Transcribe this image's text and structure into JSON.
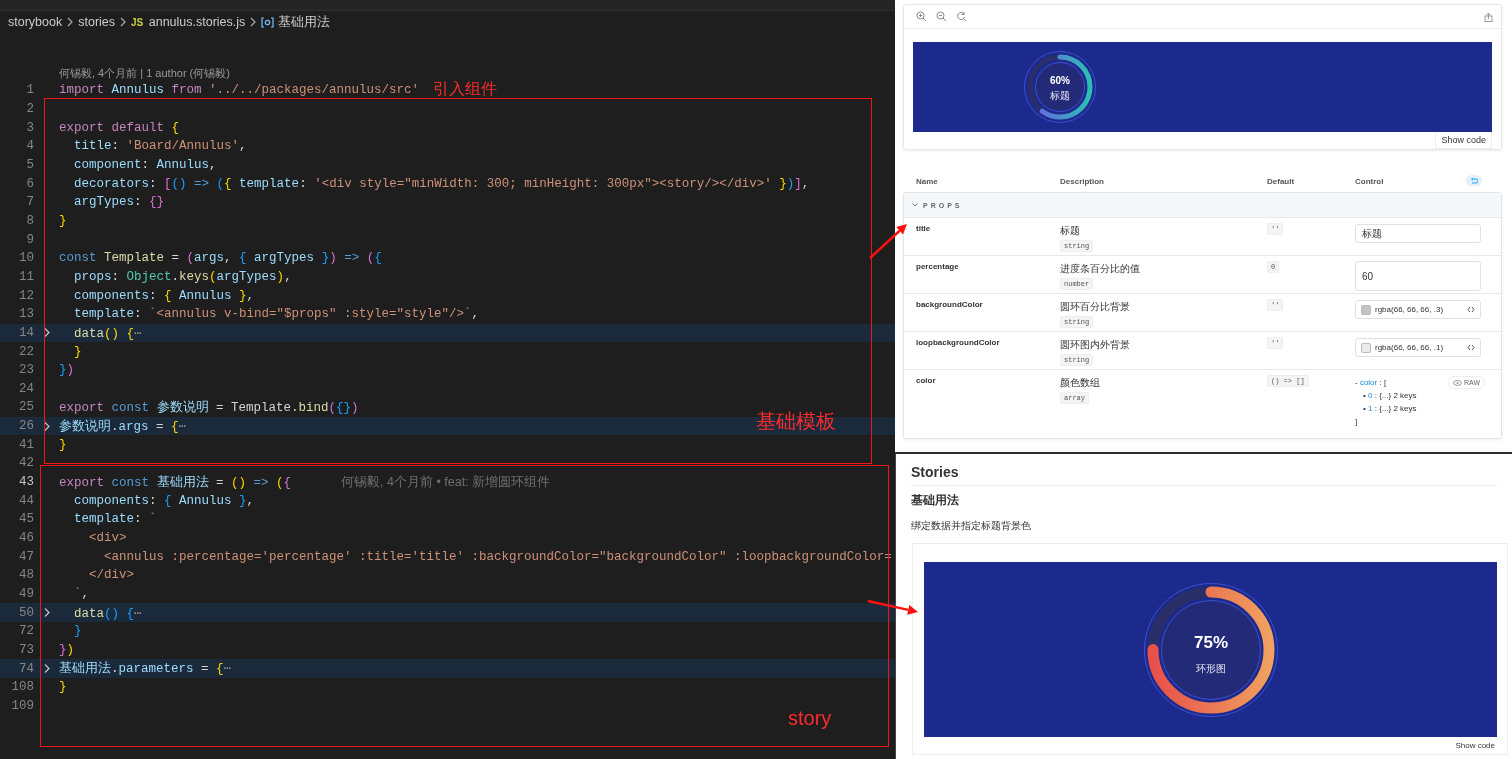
{
  "editor": {
    "breadcrumb": [
      {
        "kind": "folder",
        "text": "storybook"
      },
      {
        "kind": "folder",
        "text": "stories"
      },
      {
        "kind": "js-file",
        "badge": "JS",
        "text": "annulus.stories.js"
      },
      {
        "kind": "symbol",
        "text": "基础用法"
      }
    ],
    "codelens": "何锡毅, 4个月前 | 1 author (何锡毅)",
    "lines": [
      {
        "number": "1",
        "current": false,
        "folded": false,
        "tokens": [
          {
            "kind": "k",
            "text": "import "
          },
          {
            "kind": "v",
            "text": "Annulus "
          },
          {
            "kind": "k",
            "text": "from "
          },
          {
            "kind": "str",
            "text": "'../../packages/annulus/src'"
          }
        ]
      },
      {
        "number": "2",
        "current": false,
        "folded": false
      },
      {
        "number": "3",
        "current": false,
        "folded": false,
        "tokens": [
          {
            "kind": "k",
            "text": "export default "
          },
          {
            "kind": "y",
            "text": "{"
          }
        ]
      },
      {
        "number": "4",
        "current": false,
        "folded": false,
        "tokens": [
          {
            "kind": "v",
            "text": "  title"
          },
          {
            "kind": "p",
            "text": ": "
          },
          {
            "kind": "str",
            "text": "'Board/Annulus'"
          },
          {
            "kind": "p",
            "text": ","
          }
        ]
      },
      {
        "number": "5",
        "current": false,
        "folded": false,
        "tokens": [
          {
            "kind": "v",
            "text": "  component"
          },
          {
            "kind": "p",
            "text": ": "
          },
          {
            "kind": "v",
            "text": "Annulus"
          },
          {
            "kind": "p",
            "text": ","
          }
        ]
      },
      {
        "number": "6",
        "current": false,
        "folded": false,
        "tokens": [
          {
            "kind": "v",
            "text": "  decorators"
          },
          {
            "kind": "p",
            "text": ": "
          },
          {
            "kind": "m",
            "text": "["
          },
          {
            "kind": "b",
            "text": "()"
          },
          {
            "kind": "s",
            "text": " => "
          },
          {
            "kind": "b",
            "text": "("
          },
          {
            "kind": "y",
            "text": "{ "
          },
          {
            "kind": "v",
            "text": "template"
          },
          {
            "kind": "p",
            "text": ": "
          },
          {
            "kind": "str",
            "text": "'<div style=\"minWidth: 300; minHeight: 300px\"><story/></div>'"
          },
          {
            "kind": "y",
            "text": " }"
          },
          {
            "kind": "b",
            "text": ")"
          },
          {
            "kind": "m",
            "text": "]"
          },
          {
            "kind": "p",
            "text": ","
          }
        ]
      },
      {
        "number": "7",
        "current": false,
        "folded": false,
        "tokens": [
          {
            "kind": "v",
            "text": "  argTypes"
          },
          {
            "kind": "p",
            "text": ": "
          },
          {
            "kind": "m",
            "text": "{}"
          }
        ]
      },
      {
        "number": "8",
        "current": false,
        "folded": false,
        "tokens": [
          {
            "kind": "y",
            "text": "}"
          }
        ]
      },
      {
        "number": "9",
        "current": false,
        "folded": false
      },
      {
        "number": "10",
        "current": false,
        "folded": false,
        "tokens": [
          {
            "kind": "s",
            "text": "const "
          },
          {
            "kind": "f",
            "text": "Template"
          },
          {
            "kind": "p",
            "text": " = "
          },
          {
            "kind": "m",
            "text": "("
          },
          {
            "kind": "v",
            "text": "args"
          },
          {
            "kind": "p",
            "text": ", "
          },
          {
            "kind": "b",
            "text": "{ "
          },
          {
            "kind": "v",
            "text": "argTypes"
          },
          {
            "kind": "b",
            "text": " }"
          },
          {
            "kind": "m",
            "text": ")"
          },
          {
            "kind": "s",
            "text": " => "
          },
          {
            "kind": "m",
            "text": "("
          },
          {
            "kind": "b",
            "text": "{"
          }
        ]
      },
      {
        "number": "11",
        "current": false,
        "folded": false,
        "tokens": [
          {
            "kind": "v",
            "text": "  props"
          },
          {
            "kind": "p",
            "text": ": "
          },
          {
            "kind": "c",
            "text": "Object"
          },
          {
            "kind": "p",
            "text": "."
          },
          {
            "kind": "f",
            "text": "keys"
          },
          {
            "kind": "y",
            "text": "("
          },
          {
            "kind": "v",
            "text": "argTypes"
          },
          {
            "kind": "y",
            "text": ")"
          },
          {
            "kind": "p",
            "text": ","
          }
        ]
      },
      {
        "number": "12",
        "current": false,
        "folded": false,
        "tokens": [
          {
            "kind": "v",
            "text": "  components"
          },
          {
            "kind": "p",
            "text": ": "
          },
          {
            "kind": "y",
            "text": "{ "
          },
          {
            "kind": "v",
            "text": "Annulus"
          },
          {
            "kind": "y",
            "text": " }"
          },
          {
            "kind": "p",
            "text": ","
          }
        ]
      },
      {
        "number": "13",
        "current": false,
        "folded": false,
        "tokens": [
          {
            "kind": "v",
            "text": "  template"
          },
          {
            "kind": "p",
            "text": ": "
          },
          {
            "kind": "str",
            "text": "`<annulus v-bind=\"$props\" :style=\"style\"/>`"
          },
          {
            "kind": "p",
            "text": ","
          }
        ]
      },
      {
        "number": "14",
        "current": false,
        "folded": true,
        "tokens": [
          {
            "kind": "f",
            "text": "  data"
          },
          {
            "kind": "y",
            "text": "()"
          },
          {
            "kind": "y",
            "text": " {"
          },
          {
            "kind": "e",
            "text": "⋯"
          }
        ]
      },
      {
        "number": "22",
        "current": false,
        "folded": false,
        "tokens": [
          {
            "kind": "y",
            "text": "  }"
          }
        ]
      },
      {
        "number": "23",
        "current": false,
        "folded": false,
        "tokens": [
          {
            "kind": "b",
            "text": "}"
          },
          {
            "kind": "m",
            "text": ")"
          }
        ]
      },
      {
        "number": "24",
        "current": false,
        "folded": false
      },
      {
        "number": "25",
        "current": false,
        "folded": false,
        "tokens": [
          {
            "kind": "k",
            "text": "export "
          },
          {
            "kind": "s",
            "text": "const "
          },
          {
            "kind": "v",
            "text": "参数说明"
          },
          {
            "kind": "p",
            "text": " = Template."
          },
          {
            "kind": "f",
            "text": "bind"
          },
          {
            "kind": "m",
            "text": "("
          },
          {
            "kind": "b",
            "text": "{}"
          },
          {
            "kind": "m",
            "text": ")"
          }
        ]
      },
      {
        "number": "26",
        "current": false,
        "folded": true,
        "tokens": [
          {
            "kind": "v",
            "text": "参数说明"
          },
          {
            "kind": "p",
            "text": "."
          },
          {
            "kind": "v",
            "text": "args"
          },
          {
            "kind": "p",
            "text": " = "
          },
          {
            "kind": "y",
            "text": "{"
          },
          {
            "kind": "e",
            "text": "⋯"
          }
        ]
      },
      {
        "number": "41",
        "current": false,
        "folded": false,
        "tokens": [
          {
            "kind": "y",
            "text": "}"
          }
        ]
      },
      {
        "number": "42",
        "current": false,
        "folded": false
      },
      {
        "number": "43",
        "current": true,
        "folded": false,
        "tokens": [
          {
            "kind": "k",
            "text": "export "
          },
          {
            "kind": "s",
            "text": "const "
          },
          {
            "kind": "v",
            "text": "基础用法"
          },
          {
            "kind": "p",
            "text": " = "
          },
          {
            "kind": "y",
            "text": "()"
          },
          {
            "kind": "s",
            "text": " => "
          },
          {
            "kind": "y",
            "text": "("
          },
          {
            "kind": "m",
            "text": "{"
          }
        ],
        "blame": "何锡毅, 4个月前 • feat: 新增圆环组件"
      },
      {
        "number": "44",
        "current": false,
        "folded": false,
        "tokens": [
          {
            "kind": "v",
            "text": "  components"
          },
          {
            "kind": "p",
            "text": ": "
          },
          {
            "kind": "b",
            "text": "{ "
          },
          {
            "kind": "v",
            "text": "Annulus"
          },
          {
            "kind": "b",
            "text": " }"
          },
          {
            "kind": "p",
            "text": ","
          }
        ]
      },
      {
        "number": "45",
        "current": false,
        "folded": false,
        "tokens": [
          {
            "kind": "v",
            "text": "  template"
          },
          {
            "kind": "p",
            "text": ": "
          },
          {
            "kind": "str",
            "text": "`"
          }
        ]
      },
      {
        "number": "46",
        "current": false,
        "folded": false,
        "tokens": [
          {
            "kind": "str",
            "text": "    <div>"
          }
        ]
      },
      {
        "number": "47",
        "current": false,
        "folded": false,
        "tokens": [
          {
            "kind": "str",
            "text": "      <annulus :percentage='percentage' :title='title' :backgroundColor=\"backgroundColor\" :loopbackgroundColor="
          }
        ]
      },
      {
        "number": "48",
        "current": false,
        "folded": false,
        "tokens": [
          {
            "kind": "str",
            "text": "    </div>"
          }
        ]
      },
      {
        "number": "49",
        "current": false,
        "folded": false,
        "tokens": [
          {
            "kind": "str",
            "text": "  `"
          },
          {
            "kind": "p",
            "text": ","
          }
        ]
      },
      {
        "number": "50",
        "current": false,
        "folded": true,
        "tokens": [
          {
            "kind": "f",
            "text": "  data"
          },
          {
            "kind": "b",
            "text": "()"
          },
          {
            "kind": "b",
            "text": " {"
          },
          {
            "kind": "e",
            "text": "⋯"
          }
        ]
      },
      {
        "number": "72",
        "current": false,
        "folded": false,
        "tokens": [
          {
            "kind": "b",
            "text": "  }"
          }
        ]
      },
      {
        "number": "73",
        "current": false,
        "folded": false,
        "tokens": [
          {
            "kind": "m",
            "text": "}"
          },
          {
            "kind": "y",
            "text": ")"
          }
        ]
      },
      {
        "number": "74",
        "current": false,
        "folded": true,
        "tokens": [
          {
            "kind": "v",
            "text": "基础用法"
          },
          {
            "kind": "p",
            "text": "."
          },
          {
            "kind": "v",
            "text": "parameters"
          },
          {
            "kind": "p",
            "text": " = "
          },
          {
            "kind": "y",
            "text": "{"
          },
          {
            "kind": "e",
            "text": "⋯"
          }
        ]
      },
      {
        "number": "108",
        "current": false,
        "folded": false,
        "tokens": [
          {
            "kind": "y",
            "text": "}"
          }
        ]
      },
      {
        "number": "109",
        "current": false,
        "folded": false
      }
    ],
    "annotations": [
      {
        "kind": "note",
        "text": "引入组件"
      },
      {
        "kind": "box",
        "text": "基础模板"
      },
      {
        "kind": "box",
        "text": "story"
      },
      {
        "kind": "arrow"
      },
      {
        "kind": "arrow"
      }
    ]
  },
  "preview": {
    "ring": {
      "kind": "small",
      "level": 0.6,
      "value": "60%",
      "label": "标题"
    },
    "show_code": "Show code"
  },
  "args_table": {
    "columns": [
      "Name",
      "Description",
      "Default",
      "Control"
    ],
    "section": "PROPS",
    "section_expanded": true,
    "rows": [
      {
        "name": "title",
        "description": "标题",
        "type": "string",
        "default": "''",
        "control": {
          "kind": "text",
          "value": "标题"
        }
      },
      {
        "name": "percentage",
        "description": "进度条百分比的值",
        "type": "number",
        "default": "0",
        "control": {
          "kind": "number",
          "value": "60"
        }
      },
      {
        "name": "backgroundColor",
        "description": "圆环百分比背景",
        "type": "string",
        "default": "''",
        "control": {
          "kind": "color",
          "value": "rgba(66, 66, 66, .3)",
          "color": "#c4c4c4"
        }
      },
      {
        "name": "loopbackgroundColor",
        "description": "圆环图内外背景",
        "type": "string",
        "default": "''",
        "control": {
          "kind": "color",
          "value": "rgba(66, 66, 66, .1)",
          "color": "#ececec"
        }
      },
      {
        "name": "color",
        "description": "颜色数组",
        "type": "array",
        "default": "() => []",
        "control": {
          "kind": "object",
          "raw_button": "RAW",
          "lines": [
            [
              {
                "kind": "t",
                "text": "- "
              },
              {
                "kind": "key",
                "text": "color"
              },
              {
                "kind": "p",
                "text": " : ["
              }
            ],
            [
              {
                "kind": "t",
                "text": "• "
              },
              {
                "kind": "key",
                "text": "0"
              },
              {
                "kind": "p",
                "text": " : {...} 2 keys"
              }
            ],
            [
              {
                "kind": "t",
                "text": "• "
              },
              {
                "kind": "key",
                "text": "1"
              },
              {
                "kind": "p",
                "text": " : {...} 2 keys"
              }
            ],
            [
              {
                "kind": "p",
                "text": "]"
              }
            ]
          ]
        }
      }
    ]
  },
  "stories": {
    "heading": "Stories",
    "title": "基础用法",
    "description": "绑定数据并指定标题背景色",
    "ring": {
      "kind": "large",
      "level": 0.75,
      "value": "75%",
      "label": "环形图"
    },
    "show_code": "Show code"
  }
}
